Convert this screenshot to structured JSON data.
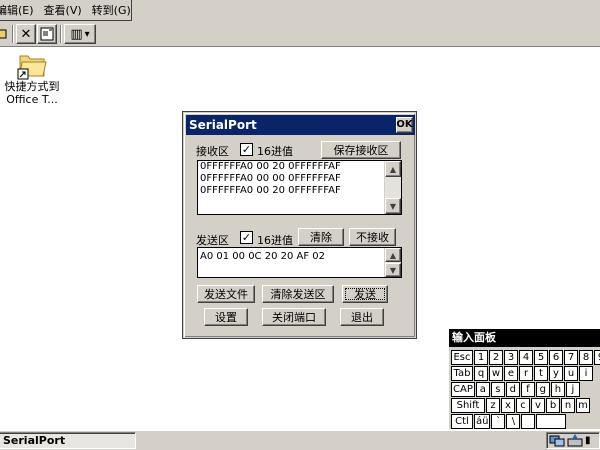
{
  "menubar": {
    "items": [
      "编辑(E)",
      "查看(V)",
      "转到(G)"
    ]
  },
  "toolbar": {
    "view_icon": "▥",
    "view_arrow": "▾",
    "delete_icon": "✕",
    "properties_icon": "▣"
  },
  "desktop": {
    "shortcut_label_line1": "快捷方式到",
    "shortcut_label_line2": "Office T..."
  },
  "dialog": {
    "title": "SerialPort",
    "ok_label": "OK",
    "receive": {
      "label": "接收区",
      "hex_checkbox_label": "16进值",
      "hex_checked": true,
      "save_button": "保存接收区",
      "lines": [
        "0FFFFFFA0 00 20 0FFFFFFAF",
        "0FFFFFFA0 00 00 0FFFFFFAF",
        "0FFFFFFA0 00 20 0FFFFFFAF"
      ]
    },
    "send": {
      "label": "发送区",
      "hex_checkbox_label": "16进值",
      "hex_checked": true,
      "clear_button": "清除",
      "no_receive_button": "不接收",
      "value": "A0 01 00 0C 20 20 AF 02"
    },
    "buttons": {
      "send_file": "发送文件",
      "clear_send": "清除发送区",
      "send": "发送",
      "settings": "设置",
      "close_port": "关闭端口",
      "exit": "退出"
    },
    "check_mark": "✓"
  },
  "input_panel": {
    "title": "输入面板",
    "rows": [
      [
        "Esc",
        "1",
        "2",
        "3",
        "4",
        "5",
        "6",
        "7",
        "8",
        "9"
      ],
      [
        "Tab",
        "q",
        "w",
        "e",
        "r",
        "t",
        "y",
        "u",
        "i"
      ],
      [
        "CAP",
        "a",
        "s",
        "d",
        "f",
        "g",
        "h",
        "j"
      ],
      [
        "Shift",
        "z",
        "x",
        "c",
        "v",
        "b",
        "n",
        "m"
      ],
      [
        "Ctl",
        "áü",
        "`",
        "\\",
        "",
        ""
      ]
    ]
  },
  "taskbar": {
    "task_label": "SerialPort",
    "tray_text": "▮"
  }
}
